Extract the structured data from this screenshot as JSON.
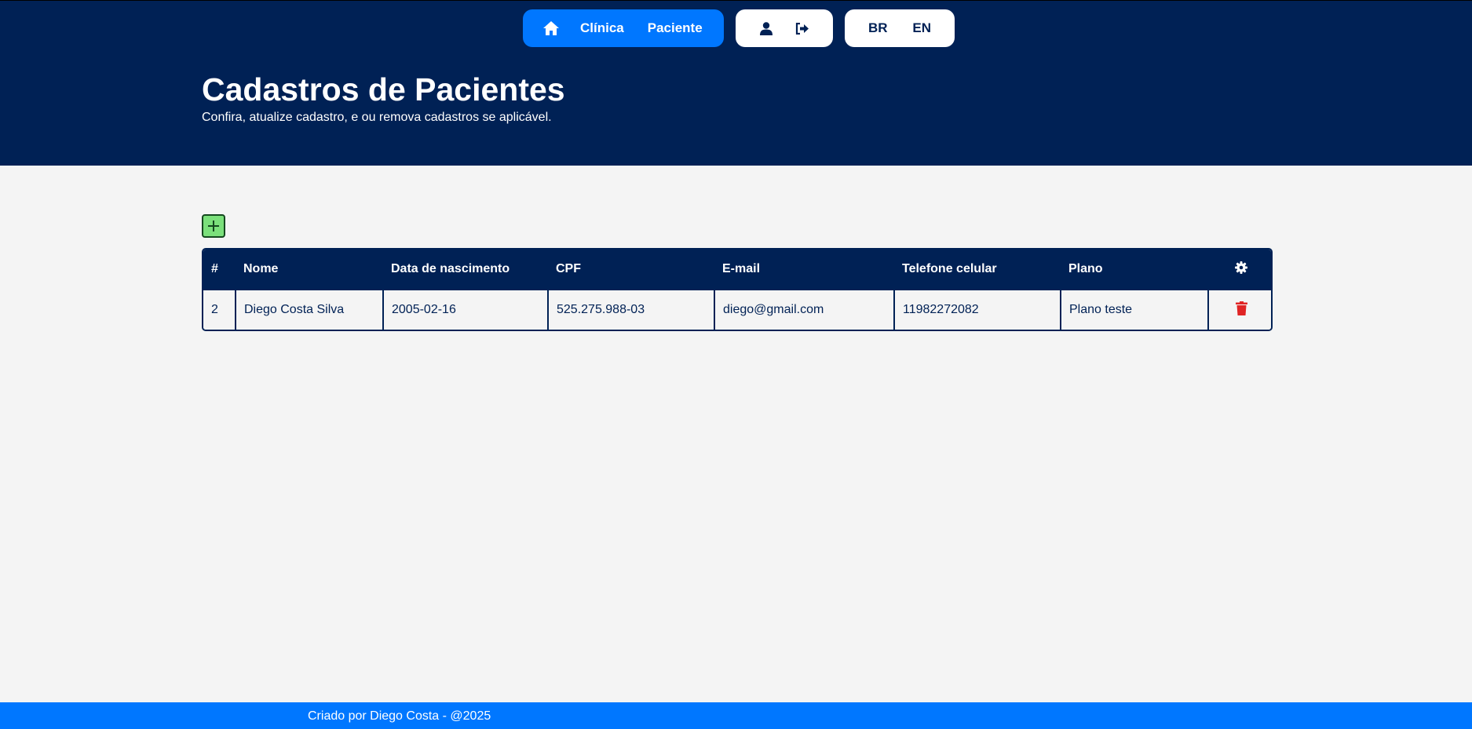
{
  "nav": {
    "home_icon": "home-icon",
    "clinic": "Clínica",
    "patient": "Paciente"
  },
  "user_menu": {
    "profile_icon": "user-icon",
    "logout_icon": "logout-icon"
  },
  "lang": {
    "br": "BR",
    "en": "EN"
  },
  "page": {
    "title": "Cadastros de Pacientes",
    "subtitle": "Confira, atualize cadastro, e ou remova cadastros se aplicável."
  },
  "add_button": {
    "icon": "plus-icon"
  },
  "table": {
    "headers": {
      "id": "#",
      "name": "Nome",
      "birth": "Data de nascimento",
      "cpf": "CPF",
      "email": "E-mail",
      "phone": "Telefone celular",
      "plan": "Plano",
      "actions_icon": "gear-icon"
    },
    "rows": [
      {
        "id": "2",
        "name": "Diego Costa Silva",
        "birth": "2005-02-16",
        "cpf": "525.275.988-03",
        "email": "diego@gmail.com",
        "phone": "11982272082",
        "plan": "Plano teste",
        "action_icon": "trash-icon"
      }
    ]
  },
  "footer": {
    "text": "Criado por Diego Costa - @2025"
  },
  "colors": {
    "header_bg": "#002155",
    "accent": "#0077ff",
    "add_green": "#7be07b",
    "delete_red": "#e02424"
  }
}
